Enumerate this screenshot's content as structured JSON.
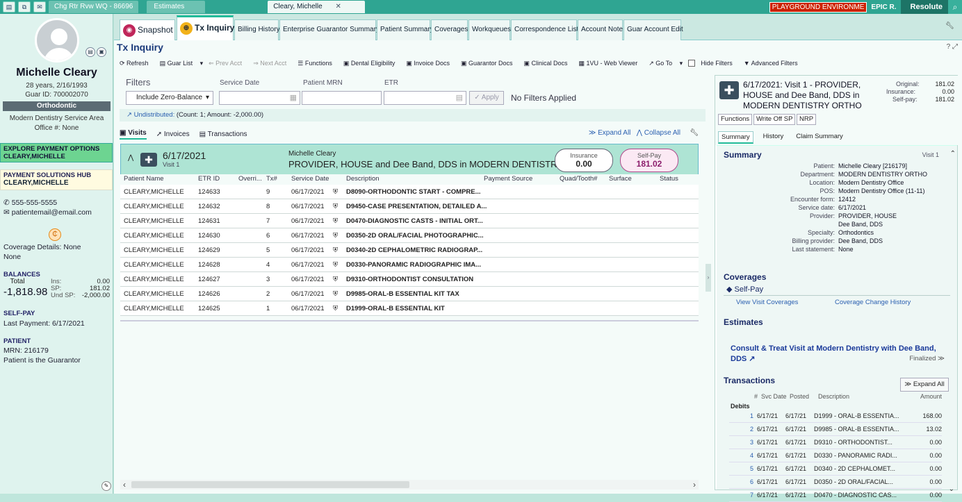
{
  "topbar": {
    "tabs": [
      "Chg Rtr Rvw WQ - 86696",
      "Estimates",
      "Cleary, Michelle"
    ],
    "env_label": "PLAYGROUND ENVIRONME",
    "user": "EPIC R.",
    "app": "Resolute"
  },
  "patient": {
    "name": "Michelle Cleary",
    "age_dob": "28 years, 2/16/1993",
    "guar_id": "Guar ID: 700002070",
    "dept_badge": "Orthodontic",
    "service_area": "Modern Dentistry Service Area",
    "office": "Office #: None",
    "explore": "EXPLORE PAYMENT OPTIONS",
    "explore_name": "CLEARY,MICHELLE",
    "hub": "PAYMENT SOLUTIONS HUB",
    "hub_name": "CLEARY,MICHELLE",
    "phone": "555-555-5555",
    "email": "patientemail@email.com",
    "coverage": "Coverage Details: None",
    "coverage2": "None",
    "balances_label": "BALANCES",
    "total_label": "Total",
    "total": "-1,818.98",
    "ins_label": "Ins:",
    "ins": "0.00",
    "sp_label": "SP:",
    "sp": "181.02",
    "undsp_label": "Und SP:",
    "undsp": "-2,000.00",
    "selfpay_label": "SELF-PAY",
    "last_payment": "Last Payment: 6/17/2021",
    "patient_label": "PATIENT",
    "mrn": "MRN: 216179",
    "guarantor": "Patient is the Guarantor"
  },
  "tabs": [
    "Snapshot",
    "Tx Inquiry",
    "Billing History",
    "Enterprise Guarantor Summary",
    "Patient Summary",
    "Coverages",
    "Workqueues",
    "Correspondence List",
    "Account Note",
    "Guar Account Edit"
  ],
  "page_title": "Tx Inquiry",
  "toolbar": [
    "Refresh",
    "Guar List",
    "Prev Acct",
    "Next Acct",
    "Functions",
    "Dental Eligibility",
    "Invoice Docs",
    "Guarantor Docs",
    "Clinical Docs",
    "1VU - Web Viewer",
    "Go To",
    "Hide Filters",
    "Advanced Filters"
  ],
  "filters": {
    "title": "Filters",
    "balance_select": "Include Zero-Balance",
    "service_date": "Service Date",
    "patient_mrn": "Patient MRN",
    "etr": "ETR",
    "apply": "Apply",
    "no_filters": "No Filters Applied",
    "undistributed_link": "Undistributed:",
    "undistributed_detail": "(Count: 1; Amount: -2,000.00)"
  },
  "subtabs": [
    "Visits",
    "Invoices",
    "Transactions"
  ],
  "expand_all": "Expand All",
  "collapse_all": "Collapse All",
  "visit": {
    "date": "6/17/2021",
    "label": "Visit 1",
    "patient": "Michelle Cleary",
    "provider": "PROVIDER, HOUSE and Dee Band, DDS in MODERN DENTISTRY OR...",
    "insurance_label": "Insurance",
    "insurance": "0.00",
    "selfpay_label": "Self-Pay",
    "selfpay": "181.02"
  },
  "columns": [
    "Patient Name",
    "ETR ID",
    "Overri...",
    "Tx#",
    "Service Date",
    "Description",
    "Payment Source",
    "Quad/Tooth#",
    "Surface",
    "Status"
  ],
  "rows": [
    {
      "name": "CLEARY,MICHELLE",
      "etr": "124633",
      "tx": "9",
      "date": "06/17/2021",
      "desc": "D8090-ORTHODONTIC START - COMPRE..."
    },
    {
      "name": "CLEARY,MICHELLE",
      "etr": "124632",
      "tx": "8",
      "date": "06/17/2021",
      "desc": "D9450-CASE PRESENTATION, DETAILED A..."
    },
    {
      "name": "CLEARY,MICHELLE",
      "etr": "124631",
      "tx": "7",
      "date": "06/17/2021",
      "desc": "D0470-DIAGNOSTIC CASTS - INITIAL ORT..."
    },
    {
      "name": "CLEARY,MICHELLE",
      "etr": "124630",
      "tx": "6",
      "date": "06/17/2021",
      "desc": "D0350-2D ORAL/FACIAL PHOTOGRAPHIC..."
    },
    {
      "name": "CLEARY,MICHELLE",
      "etr": "124629",
      "tx": "5",
      "date": "06/17/2021",
      "desc": "D0340-2D CEPHALOMETRIC RADIOGRAP..."
    },
    {
      "name": "CLEARY,MICHELLE",
      "etr": "124628",
      "tx": "4",
      "date": "06/17/2021",
      "desc": "D0330-PANORAMIC RADIOGRAPHIC IMA..."
    },
    {
      "name": "CLEARY,MICHELLE",
      "etr": "124627",
      "tx": "3",
      "date": "06/17/2021",
      "desc": "D9310-ORTHODONTIST CONSULTATION"
    },
    {
      "name": "CLEARY,MICHELLE",
      "etr": "124626",
      "tx": "2",
      "date": "06/17/2021",
      "desc": "D9985-ORAL-B ESSENTIAL KIT TAX"
    },
    {
      "name": "CLEARY,MICHELLE",
      "etr": "124625",
      "tx": "1",
      "date": "06/17/2021",
      "desc": "D1999-ORAL-B ESSENTIAL KIT"
    }
  ],
  "panel": {
    "title": "6/17/2021: Visit 1 - PROVIDER, HOUSE and Dee Band, DDS in MODERN DENTISTRY ORTHO",
    "original_label": "Original:",
    "original": "181.02",
    "insurance_label": "Insurance:",
    "insurance": "0.00",
    "selfpay_label": "Self-pay:",
    "selfpay": "181.02",
    "buttons": [
      "Functions",
      "Write Off SP",
      "NRP"
    ],
    "tabs": [
      "Summary",
      "History",
      "Claim Summary"
    ],
    "summary_title": "Summary",
    "visit_label": "Visit 1",
    "summary": [
      {
        "k": "Patient:",
        "v": "Michelle Cleary [216179]"
      },
      {
        "k": "Department:",
        "v": "MODERN DENTISTRY ORTHO"
      },
      {
        "k": "Location:",
        "v": "Modern Dentistry Office"
      },
      {
        "k": "POS:",
        "v": "Modern Dentistry Office (11-11)"
      },
      {
        "k": "Encounter form:",
        "v": "12412"
      },
      {
        "k": "Service date:",
        "v": "6/17/2021"
      },
      {
        "k": "Provider:",
        "v": "PROVIDER, HOUSE"
      },
      {
        "k": "",
        "v": "Dee Band, DDS"
      },
      {
        "k": "Specialty:",
        "v": "Orthodontics"
      },
      {
        "k": "Billing provider:",
        "v": "Dee Band, DDS"
      },
      {
        "k": "Last statement:",
        "v": "None"
      }
    ],
    "coverages_title": "Coverages",
    "coverage_name": "Self-Pay",
    "view_coverages": "View Visit Coverages",
    "coverage_history": "Coverage Change History",
    "estimates_title": "Estimates",
    "estimate_link": "Consult & Treat Visit at Modern Dentistry with Dee Band, DDS",
    "finalized": "Finalized",
    "transactions_title": "Transactions",
    "expand_all": "Expand All",
    "tx_columns": [
      "#",
      "Svc Date",
      "Posted",
      "Description",
      "Amount"
    ],
    "debits_label": "Debits",
    "transactions": [
      {
        "n": "1",
        "svc": "6/17/21",
        "posted": "6/17/21",
        "desc": "D1999 - ORAL-B ESSENTIA...",
        "amt": "168.00"
      },
      {
        "n": "2",
        "svc": "6/17/21",
        "posted": "6/17/21",
        "desc": "D9985 - ORAL-B ESSENTIA...",
        "amt": "13.02"
      },
      {
        "n": "3",
        "svc": "6/17/21",
        "posted": "6/17/21",
        "desc": "D9310 - ORTHODONTIST...",
        "amt": "0.00"
      },
      {
        "n": "4",
        "svc": "6/17/21",
        "posted": "6/17/21",
        "desc": "D0330 - PANORAMIC RADI...",
        "amt": "0.00"
      },
      {
        "n": "5",
        "svc": "6/17/21",
        "posted": "6/17/21",
        "desc": "D0340 - 2D CEPHALOMET...",
        "amt": "0.00"
      },
      {
        "n": "6",
        "svc": "6/17/21",
        "posted": "6/17/21",
        "desc": "D0350 - 2D ORAL/FACIAL...",
        "amt": "0.00"
      },
      {
        "n": "7",
        "svc": "6/17/21",
        "posted": "6/17/21",
        "desc": "D0470 - DIAGNOSTIC CAS...",
        "amt": "0.00"
      }
    ]
  }
}
